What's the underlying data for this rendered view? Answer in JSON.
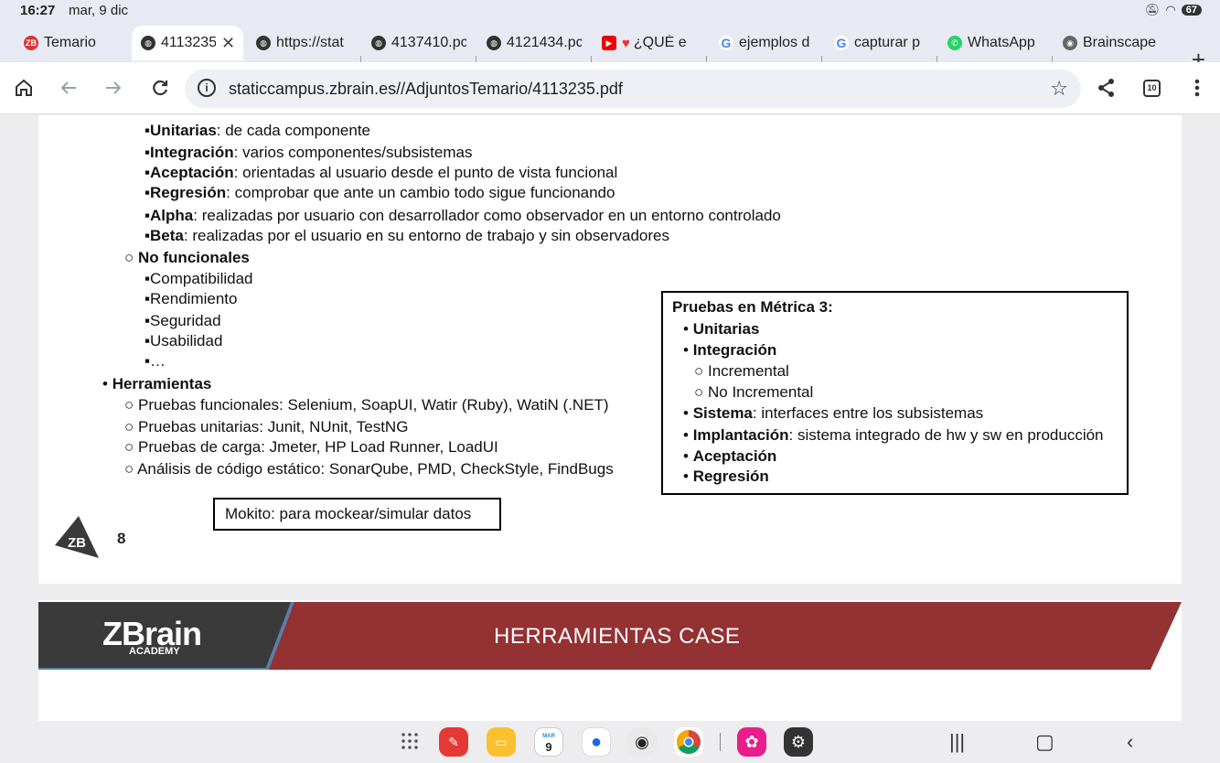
{
  "status": {
    "time": "16:27",
    "date": "mar, 9 dic",
    "battery": "67"
  },
  "tabs": [
    {
      "label": "Temario",
      "icon": "zb-favicon"
    },
    {
      "label": "4113235.",
      "icon": "globe-favicon",
      "active": true,
      "close": "✕"
    },
    {
      "label": "https://stat",
      "icon": "globe-favicon"
    },
    {
      "label": "4137410.pc",
      "icon": "globe-favicon"
    },
    {
      "label": "4121434.pc",
      "icon": "globe-favicon"
    },
    {
      "label": "¿QUÉ e",
      "icon": "youtube-favicon"
    },
    {
      "label": "ejemplos d",
      "icon": "google-favicon"
    },
    {
      "label": "capturar p",
      "icon": "google-favicon"
    },
    {
      "label": "WhatsApp",
      "icon": "whatsapp-favicon"
    },
    {
      "label": "Brainscape",
      "icon": "brainscape-favicon"
    }
  ],
  "new_tab": "+",
  "toolbar": {
    "url": "staticcampus.zbrain.es//AdjuntosTemario/4113235.pdf",
    "tab_count": "10"
  },
  "doc": {
    "list_items": [
      {
        "bold": "Unitarias",
        "rest": ": de cada componente"
      },
      {
        "bold": "Integración",
        "rest": ": varios componentes/subsistemas"
      },
      {
        "bold": "Aceptación",
        "rest": ": orientadas al usuario desde el punto de vista funcional"
      },
      {
        "bold": "Regresión",
        "rest": ": comprobar que ante un cambio todo sigue funcionando"
      },
      {
        "bold": "Alpha",
        "rest": ": realizadas por usuario con desarrollador como observador en un entorno controlado"
      },
      {
        "bold": "Beta",
        "rest": ": realizadas por el usuario en su entorno de trabajo y sin observadores"
      }
    ],
    "no_funcionales": "No funcionales",
    "nf_items": [
      "Compatibilidad",
      "Rendimiento",
      "Seguridad",
      "Usabilidad",
      "…"
    ],
    "herramientas": "Herramientas",
    "tools": [
      "Pruebas funcionales: Selenium, SoapUI, Watir (Ruby), WatiN (.NET)",
      "Pruebas unitarias: Junit, NUnit, TestNG",
      "Pruebas de carga: Jmeter, HP Load Runner, LoadUI",
      "Análisis de código estático: SonarQube, PMD, CheckStyle, FindBugs"
    ],
    "mokito": "Mokito: para mockear/simular datos",
    "metrica": {
      "title": "Pruebas en Métrica 3:",
      "unitarias": "Unitarias",
      "integracion": "Integración",
      "incremental": "Incremental",
      "no_incremental": "No Incremental",
      "sistema_bold": "Sistema",
      "sistema_rest": ": interfaces entre los subsistemas",
      "implantacion_bold": "Implantación",
      "implantacion_rest": ": sistema integrado de hw y sw en producción",
      "aceptacion": "Aceptación",
      "regresion": "Regresión"
    },
    "logo_text": "ZB",
    "page_number": "8"
  },
  "banner": {
    "brand": "ZBrain",
    "brand_sub": "ACADEMY",
    "title": "HERRAMIENTAS CASE"
  },
  "dock": {
    "calendar_month": "MAR",
    "calendar_day": "9"
  },
  "colors": {
    "banner_red": "#933133",
    "banner_dark": "#3a3a3a",
    "banner_stripe": "#5a7fa8"
  }
}
